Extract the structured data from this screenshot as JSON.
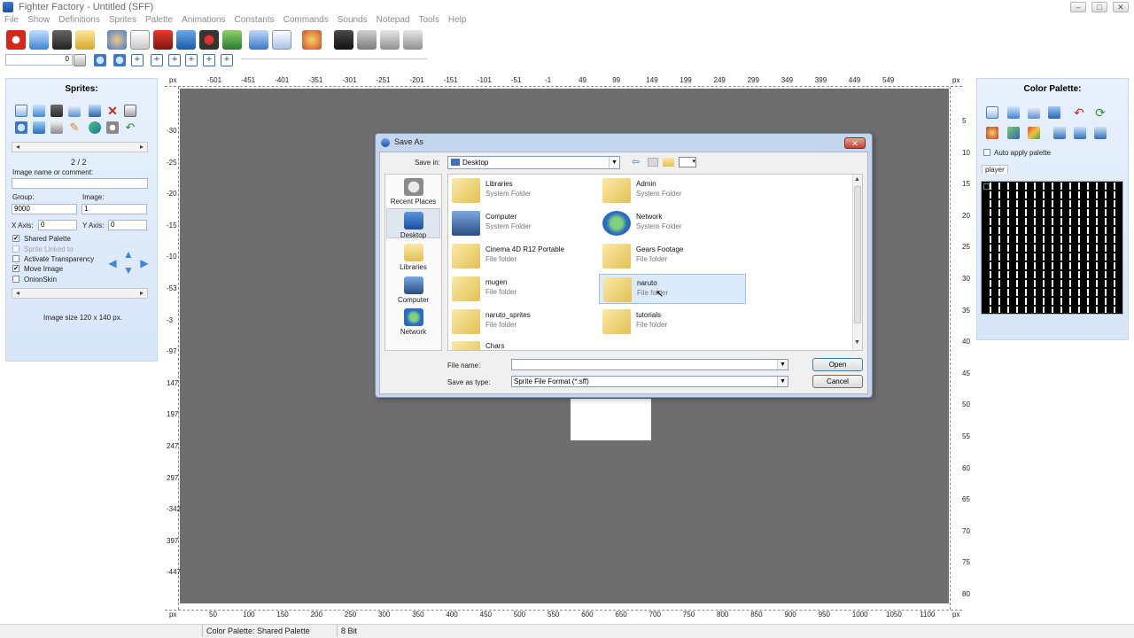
{
  "window": {
    "title": "Fighter Factory - Untitled (SFF)",
    "controls": [
      "–",
      "□",
      "✕"
    ]
  },
  "menu": [
    "File",
    "Show",
    "Definitions",
    "Sprites",
    "Palette",
    "Animations",
    "Constants",
    "Commands",
    "Sounds",
    "Notepad",
    "Tools",
    "Help"
  ],
  "toolbar2": {
    "frame_value": "0"
  },
  "sprites_panel": {
    "title": "Sprites:",
    "counter": "2 / 2",
    "image_name_label": "Image name or comment:",
    "image_name_value": "",
    "group_label": "Group:",
    "group_value": "9000",
    "image_label": "Image:",
    "image_value": "1",
    "xaxis_label": "X Axis:",
    "xaxis_value": "0",
    "yaxis_label": "Y Axis:",
    "yaxis_value": "0",
    "checkboxes": [
      {
        "label": "Shared Palette",
        "checked": true,
        "mark": "✔"
      },
      {
        "label": "Sprite Linked to",
        "checked": false,
        "mark": ""
      },
      {
        "label": "Activate Transparency",
        "checked": false,
        "mark": ""
      },
      {
        "label": "Move Image",
        "checked": true,
        "mark": "✔"
      },
      {
        "label": "OnionSkin",
        "checked": false,
        "mark": ""
      }
    ],
    "image_size": "Image size 120 x 140 px."
  },
  "rulers": {
    "top_unit": "px",
    "top_ticks": [
      "-501",
      "-451",
      "-401",
      "-351",
      "-301",
      "-251",
      "-201",
      "-151",
      "-101",
      "-51",
      "-1",
      "49",
      "99",
      "149",
      "199",
      "249",
      "299",
      "349",
      "399",
      "449",
      "549"
    ],
    "bottom_ticks": [
      "50",
      "100",
      "150",
      "200",
      "250",
      "300",
      "350",
      "400",
      "450",
      "500",
      "550",
      "600",
      "650",
      "700",
      "750",
      "800",
      "850",
      "900",
      "950",
      "1000",
      "1050",
      "1100"
    ],
    "left_ticks": [
      "-30",
      "-25",
      "-20",
      "-15",
      "-10",
      "-53",
      "-3",
      "-97",
      "147",
      "197",
      "247",
      "297",
      "-342",
      "397",
      "-447"
    ],
    "right_ticks": [
      "5",
      "10",
      "15",
      "20",
      "25",
      "30",
      "35",
      "40",
      "45",
      "50",
      "55",
      "60",
      "65",
      "70",
      "75",
      "80"
    ]
  },
  "palette_panel": {
    "title": "Color Palette:",
    "auto_apply": "Auto apply palette",
    "tab": "player"
  },
  "status_bar": {
    "palette": "Color Palette: Shared Palette",
    "bits": "8 Bit"
  },
  "dialog": {
    "title": "Save As",
    "close": "✕",
    "save_in_label": "Save in:",
    "save_in_value": "Desktop",
    "places": [
      "Recent Places",
      "Desktop",
      "Libraries",
      "Computer",
      "Network"
    ],
    "items": [
      {
        "name": "Libraries",
        "type": "System Folder"
      },
      {
        "name": "Admin",
        "type": "System Folder"
      },
      {
        "name": "Computer",
        "type": "System Folder"
      },
      {
        "name": "Network",
        "type": "System Folder"
      },
      {
        "name": "Cinema 4D R12 Portable",
        "type": "File folder"
      },
      {
        "name": "Gears Footage",
        "type": "File folder"
      },
      {
        "name": "mugen",
        "type": "File folder"
      },
      {
        "name": "naruto",
        "type": "File folder"
      },
      {
        "name": "naruto_sprites",
        "type": "File folder"
      },
      {
        "name": "tutorials",
        "type": "File folder"
      },
      {
        "name": "Chars",
        "type": ""
      }
    ],
    "selected_item": "naruto",
    "file_name_label": "File name:",
    "file_name_value": "",
    "save_type_label": "Save as type:",
    "save_type_value": "Sprite File Format (*.sff)",
    "open_button": "Open",
    "cancel_button": "Cancel"
  }
}
